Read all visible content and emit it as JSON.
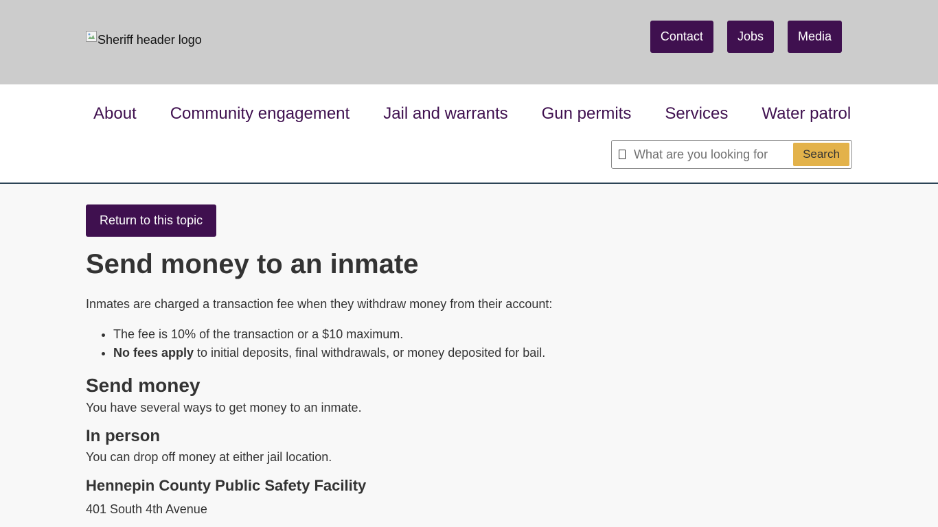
{
  "header": {
    "logo_alt": "Sheriff header logo",
    "utility_nav": [
      {
        "label": "Contact"
      },
      {
        "label": "Jobs"
      },
      {
        "label": "Media"
      }
    ]
  },
  "main_nav": [
    {
      "label": "About"
    },
    {
      "label": "Community engagement"
    },
    {
      "label": "Jail and warrants"
    },
    {
      "label": "Gun permits"
    },
    {
      "label": "Services"
    },
    {
      "label": "Water patrol"
    }
  ],
  "search": {
    "placeholder": "What are you looking for",
    "value": "",
    "button_label": "Search"
  },
  "content": {
    "return_label": "Return to this topic",
    "title": "Send money to an inmate",
    "intro": "Inmates are charged a transaction fee when they withdraw money from their account:",
    "fee_item_1": "The fee is 10% of the transaction or a $10 maximum.",
    "fee_item_2_bold": "No fees apply",
    "fee_item_2_rest": " to initial deposits, final withdrawals, or money deposited for bail.",
    "send_money_heading": "Send money",
    "send_money_text": "You have several ways to get money to an inmate.",
    "in_person_heading": "In person",
    "in_person_text": "You can drop off money at either jail location.",
    "location_heading": "Hennepin County Public Safety Facility",
    "location_address": "401 South 4th Avenue"
  },
  "colors": {
    "brand_purple": "#3f104f",
    "search_button": "#e3b24a",
    "header_gray": "#cccccc"
  }
}
